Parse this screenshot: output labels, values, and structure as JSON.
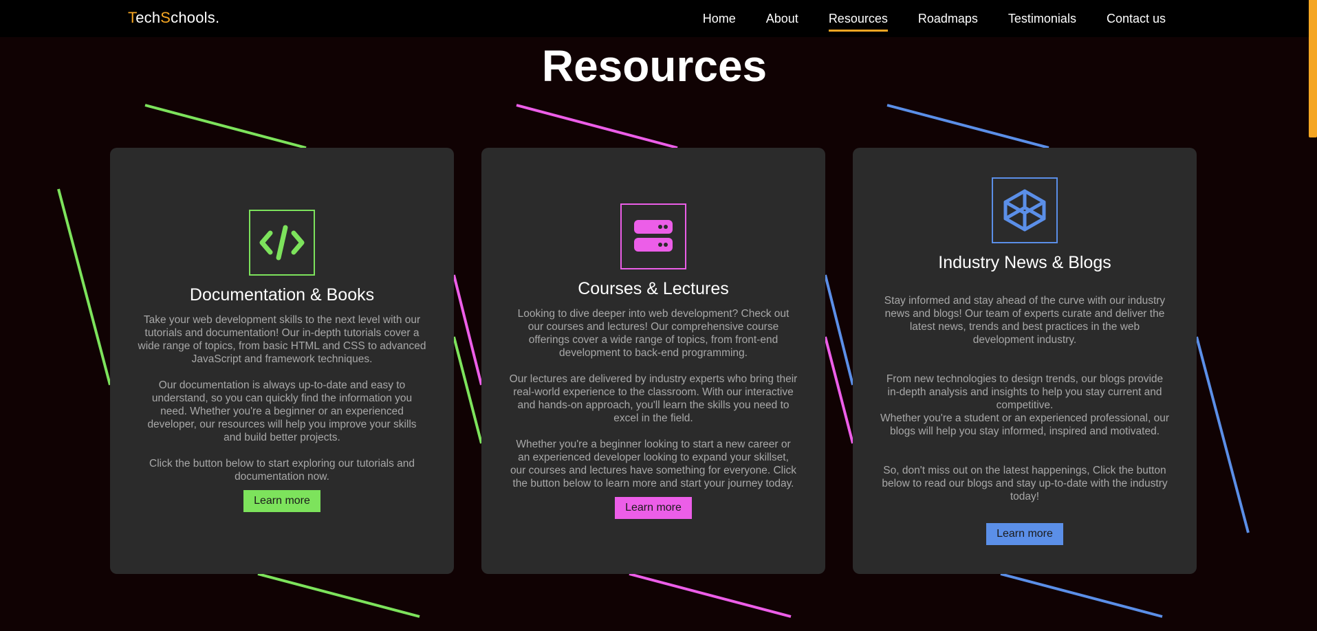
{
  "brand": {
    "part1": "T",
    "part2": "ech",
    "part3": "S",
    "part4": "chools."
  },
  "nav": {
    "items": [
      {
        "label": "Home"
      },
      {
        "label": "About"
      },
      {
        "label": "Resources"
      },
      {
        "label": "Roadmaps"
      },
      {
        "label": "Testimonials"
      },
      {
        "label": "Contact us"
      }
    ],
    "active": "Resources"
  },
  "page": {
    "title": "Resources"
  },
  "colors": {
    "accent": "#f5a623",
    "green": "#7de35c",
    "pink": "#ec5ee8",
    "blue": "#5b8fe8",
    "card": "#2b2b2b"
  },
  "cards": [
    {
      "icon": "code-icon",
      "title": "Documentation & Books",
      "paragraphs": [
        "Take your web development skills to the next level with our tutorials and documentation! Our in-depth tutorials cover a wide range of topics, from basic HTML and CSS to advanced JavaScript and framework techniques.",
        "Our documentation is always up-to-date and easy to understand, so you can quickly find the information you need. Whether you're a beginner or an experienced developer, our resources will help you improve your skills and build better projects.",
        "Click the button below to start exploring our tutorials and documentation now."
      ],
      "button": "Learn more"
    },
    {
      "icon": "server-icon",
      "title": "Courses & Lectures",
      "paragraphs": [
        "Looking to dive deeper into web development? Check out our courses and lectures! Our comprehensive course offerings cover a wide range of topics, from front-end development to back-end programming.",
        "Our lectures are delivered by industry experts who bring their real-world experience to the classroom. With our interactive and hands-on approach, you'll learn the skills you need to excel in the field.",
        "Whether you're a beginner looking to start a new career or an experienced developer looking to expand your skillset, our courses and lectures have something for everyone. Click the button below to learn more and start your journey today."
      ],
      "button": "Learn more"
    },
    {
      "icon": "codepen-icon",
      "title": "Industry News & Blogs",
      "paragraphs": [
        "Stay informed and stay ahead of the curve with our industry news and blogs! Our team of experts curate and deliver the latest news, trends and best practices in the web development industry.",
        "From new technologies to design trends, our blogs provide in-depth analysis and insights to help you stay current and competitive.\nWhether you're a student or an experienced professional, our blogs will help you stay informed, inspired and motivated.",
        "So, don't miss out on the latest happenings, Click the button below to read our blogs and stay up-to-date with the industry today!"
      ],
      "button": "Learn more"
    }
  ]
}
